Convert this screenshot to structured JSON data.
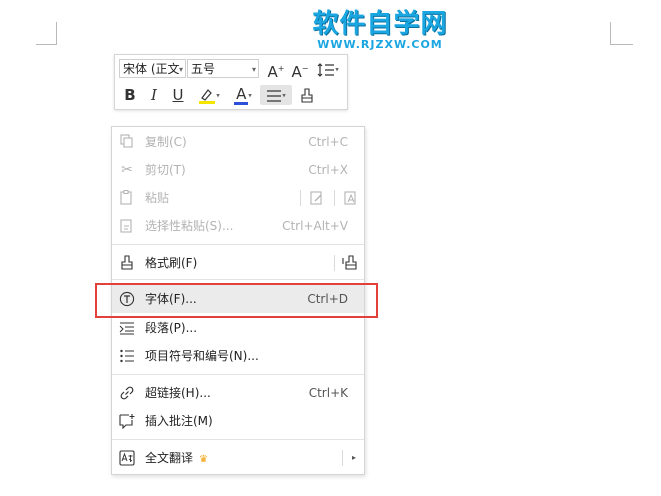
{
  "watermark": {
    "title": "软件自学网",
    "subtitle": "WWW.RJZXW.COM"
  },
  "mini_toolbar": {
    "font_name": "宋体 (正文",
    "font_size": "五号",
    "grow_font": "A",
    "shrink_font": "A",
    "bold": "B",
    "italic": "I",
    "underline": "U",
    "font_color": "A"
  },
  "menu": {
    "copy": {
      "label": "复制(C)",
      "shortcut": "Ctrl+C"
    },
    "cut": {
      "label": "剪切(T)",
      "shortcut": "Ctrl+X"
    },
    "paste": {
      "label": "粘贴"
    },
    "paste_special": {
      "label": "选择性粘贴(S)...",
      "shortcut": "Ctrl+Alt+V"
    },
    "format_painter": {
      "label": "格式刷(F)"
    },
    "font": {
      "label": "字体(F)...",
      "shortcut": "Ctrl+D"
    },
    "paragraph": {
      "label": "段落(P)..."
    },
    "bullets": {
      "label": "项目符号和编号(N)..."
    },
    "hyperlink": {
      "label": "超链接(H)...",
      "shortcut": "Ctrl+K"
    },
    "comment": {
      "label": "插入批注(M)"
    },
    "translate": {
      "label": "全文翻译"
    }
  },
  "colors": {
    "highlight_box": "#e3403a",
    "watermark": "#1aa6e0",
    "crown": "#f2a20f",
    "font_color_bar": "#2b4fd8",
    "highlight_color_bar": "#f5e600"
  }
}
